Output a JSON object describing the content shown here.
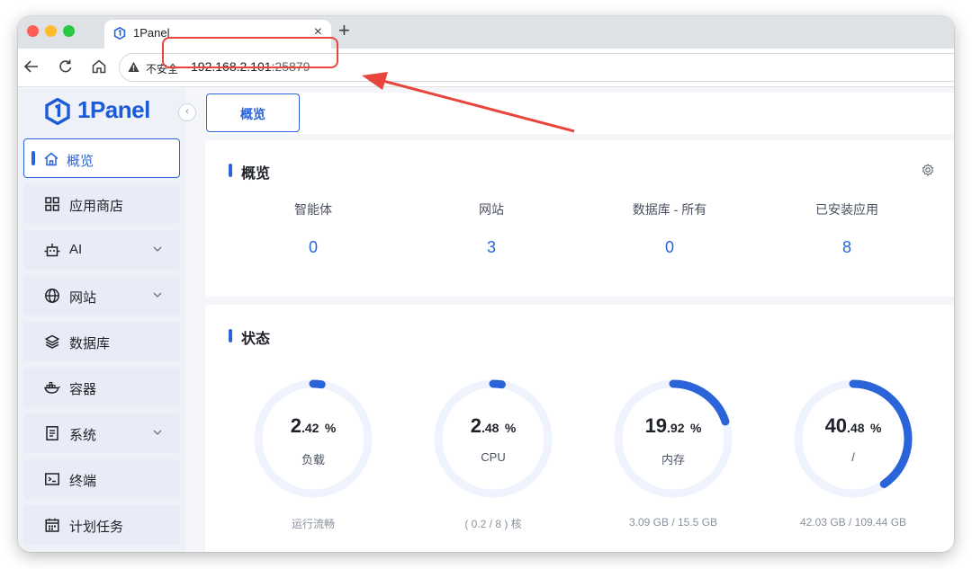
{
  "browser": {
    "tab_title": "1Panel",
    "tab_close": "×",
    "new_tab": "+",
    "insecure_label": "不安全",
    "url_host": "192.168.2.101",
    "url_port": ":25879"
  },
  "sidebar": {
    "brand": "1Panel",
    "collapse": "‹",
    "items": [
      {
        "label": "概览",
        "icon": "home-icon"
      },
      {
        "label": "应用商店",
        "icon": "grid-icon"
      },
      {
        "label": "AI",
        "icon": "robot-icon"
      },
      {
        "label": "网站",
        "icon": "globe-icon"
      },
      {
        "label": "数据库",
        "icon": "layers-icon"
      },
      {
        "label": "容器",
        "icon": "docker-icon"
      },
      {
        "label": "系统",
        "icon": "system-icon"
      },
      {
        "label": "终端",
        "icon": "terminal-icon"
      },
      {
        "label": "计划任务",
        "icon": "calendar-icon"
      }
    ]
  },
  "main": {
    "tab_label": "概览",
    "overview": {
      "title": "概览",
      "stats": [
        {
          "label": "智能体",
          "value": "0"
        },
        {
          "label": "网站",
          "value": "3"
        },
        {
          "label": "数据库 - 所有",
          "value": "0"
        },
        {
          "label": "已安装应用",
          "value": "8"
        }
      ]
    },
    "status": {
      "title": "状态",
      "gauges": [
        {
          "int": "2",
          "dec": ".42",
          "unit": "%",
          "percent": 2.42,
          "name": "负载",
          "sub": "运行流畅"
        },
        {
          "int": "2",
          "dec": ".48",
          "unit": "%",
          "percent": 2.48,
          "name": "CPU",
          "sub": "( 0.2 / 8 ) 核"
        },
        {
          "int": "19",
          "dec": ".92",
          "unit": "%",
          "percent": 19.92,
          "name": "内存",
          "sub": "3.09 GB / 15.5 GB"
        },
        {
          "int": "40",
          "dec": ".48",
          "unit": "%",
          "percent": 40.48,
          "name": "/",
          "sub": "42.03 GB / 109.44 GB"
        }
      ]
    }
  },
  "colors": {
    "accent": "#2b63d9",
    "gauge_track": "#eef3fe",
    "annotation": "#e8453c"
  }
}
